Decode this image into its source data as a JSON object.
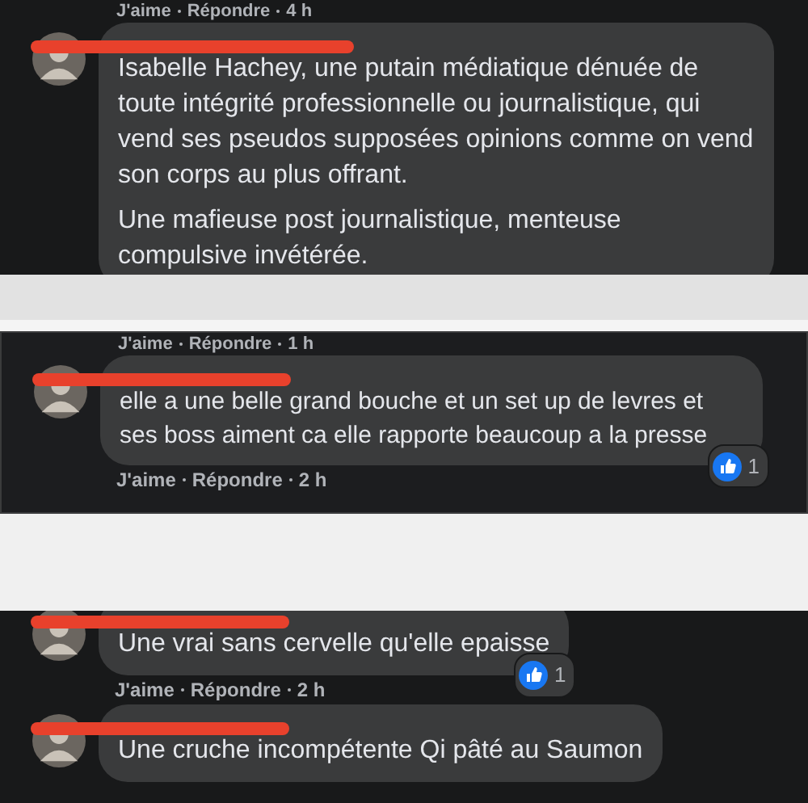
{
  "panels": [
    {
      "lead_meta": {
        "like": "J'aime",
        "reply": "Répondre",
        "time": "4 h"
      },
      "comments": [
        {
          "redacted": true,
          "paragraphs": [
            "Isabelle Hachey, une putain médiatique dénuée de toute intégrité professionnelle ou journalistique, qui vend ses pseudos supposées opinions comme on vend son corps au plus offrant.",
            "Une mafieuse post journalistique, menteuse compulsive invétérée."
          ]
        }
      ]
    },
    {
      "lead_meta": {
        "like": "J'aime",
        "reply": "Répondre",
        "time": "1 h"
      },
      "comments": [
        {
          "redacted": true,
          "paragraphs": [
            "elle a une belle grand bouche et un set up de levres et ses boss aiment ca elle rapporte beaucoup a la presse"
          ],
          "meta": {
            "like": "J'aime",
            "reply": "Répondre",
            "time": "2 h"
          },
          "reactions": "1"
        }
      ]
    },
    {
      "comments": [
        {
          "redacted": true,
          "paragraphs": [
            "Une vrai sans cervelle qu'elle epaisse"
          ],
          "meta": {
            "like": "J'aime",
            "reply": "Répondre",
            "time": "2 h"
          },
          "reactions": "1"
        },
        {
          "redacted": true,
          "paragraphs": [
            "Une cruche incompétente Qi pâté au Saumon"
          ]
        }
      ]
    }
  ]
}
